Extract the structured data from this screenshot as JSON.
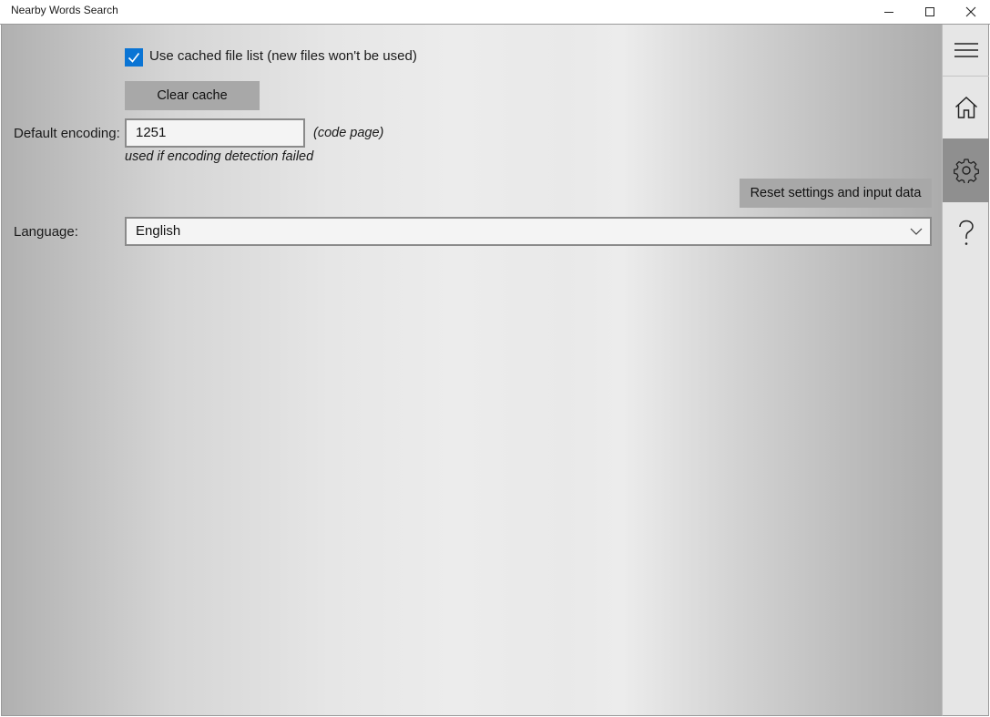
{
  "window": {
    "title": "Nearby Words Search"
  },
  "settings": {
    "use_cached_label": "Use cached file list (new files won't be used)",
    "use_cached_checked": true,
    "clear_cache_label": "Clear cache",
    "default_encoding_label": "Default encoding:",
    "default_encoding_value": "1251",
    "code_page_hint": "(code page)",
    "encoding_fallback_hint": "used if encoding detection failed",
    "reset_label": "Reset settings and input data",
    "language_label": "Language:",
    "language_value": "English"
  },
  "nav": {
    "items": [
      {
        "icon": "hamburger-menu-icon"
      },
      {
        "icon": "home-icon"
      },
      {
        "icon": "gear-icon",
        "selected": true
      },
      {
        "icon": "question-mark-icon"
      }
    ]
  },
  "colors": {
    "accent": "#0a74d4",
    "button_bg": "#a8a8a8",
    "selected_nav_bg": "#8f8f8f"
  }
}
